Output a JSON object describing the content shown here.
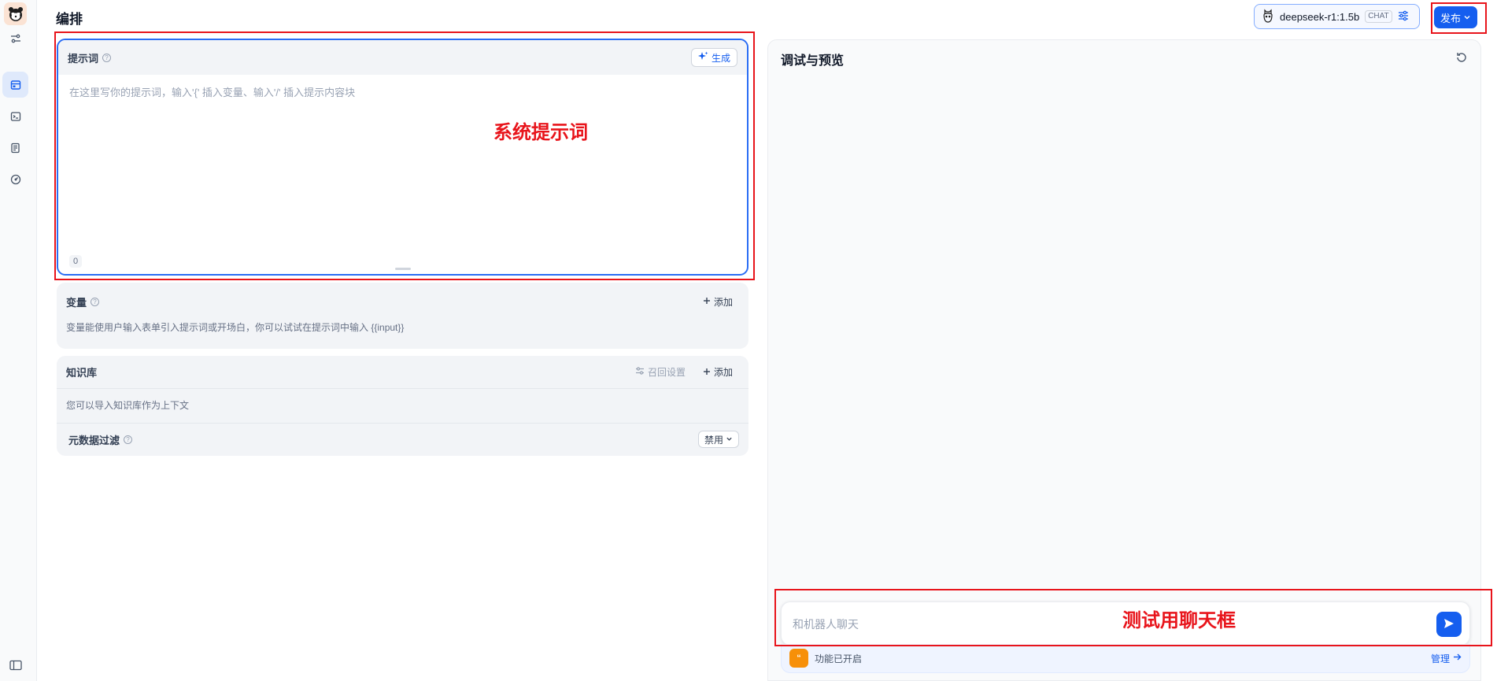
{
  "header": {
    "title": "编排",
    "model": {
      "name": "deepseek-r1:1.5b",
      "badge": "CHAT"
    },
    "publish_label": "发布"
  },
  "prompt": {
    "title": "提示词",
    "generate_label": "生成",
    "placeholder": "在这里写你的提示词，输入'{' 插入变量、输入'/' 插入提示内容块",
    "value": "",
    "char_count": "0"
  },
  "variables": {
    "title": "变量",
    "add_label": "添加",
    "description": "变量能使用户输入表单引入提示词或开场白，你可以试试在提示词中输入 {{input}}"
  },
  "knowledge": {
    "title": "知识库",
    "recall_label": "召回设置",
    "add_label": "添加",
    "description": "您可以导入知识库作为上下文",
    "metadata_filter": {
      "title": "元数据过滤",
      "value": "禁用"
    }
  },
  "debug": {
    "title": "调试与预览",
    "chat_placeholder": "和机器人聊天",
    "feature_text": "功能已开启",
    "manage_label": "管理"
  },
  "annotations": {
    "system_prompt": "系统提示词",
    "chat_box": "测试用聊天框"
  },
  "colors": {
    "primary": "#155eef",
    "annotation": "#e8141b",
    "feature_icon": "#f79009"
  },
  "icons": {
    "rail": [
      "app-logo-icon",
      "sliders-icon",
      "layout-icon",
      "terminal-icon",
      "log-icon",
      "gauge-icon",
      "sidebar-toggle-icon"
    ]
  }
}
